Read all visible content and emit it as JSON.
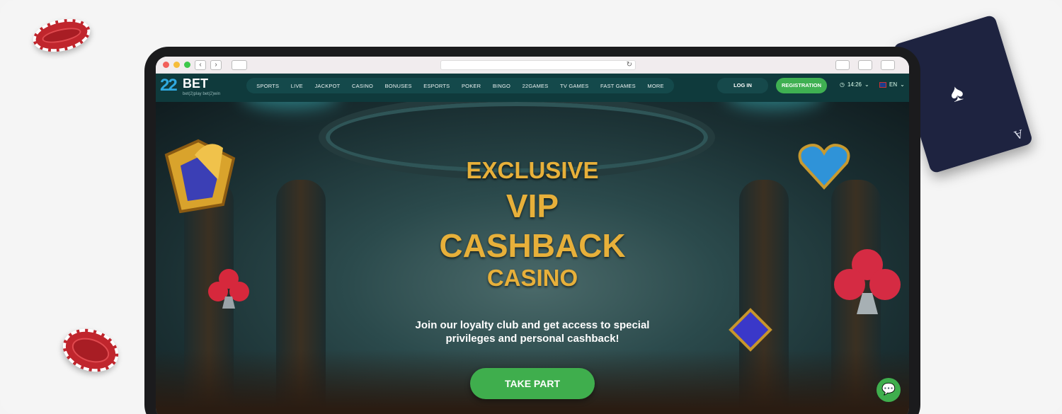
{
  "site": {
    "logo": {
      "mark": "22",
      "name": "BET",
      "tagline": "bet(2)play  bet(2)win"
    },
    "menu": [
      "SPORTS",
      "LIVE",
      "JACKPOT",
      "CASINO",
      "BONUSES",
      "ESPORTS",
      "POKER",
      "BINGO",
      "22GAMES",
      "TV GAMES",
      "FAST GAMES",
      "MORE"
    ],
    "login_label": "LOG IN",
    "registration_label": "REGISTRATION",
    "time": "14:26",
    "language": "EN"
  },
  "hero": {
    "line1": "EXCLUSIVE",
    "line2": "VIP",
    "line3": "CASHBACK",
    "line4": "CASINO",
    "subtitle_line1": "Join our loyalty club and get access to special",
    "subtitle_line2": "privileges and personal cashback!",
    "cta_label": "TAKE PART"
  },
  "colors": {
    "accent_green": "#3fae4d",
    "gold": "#e7b03a",
    "nav_bg": "#0f3a3c"
  },
  "icons": [
    "back-icon",
    "forward-icon",
    "sidebar-icon",
    "reload-icon",
    "share-icon",
    "tabs-icon",
    "download-icon",
    "clock-icon",
    "flag-icon",
    "chat-icon"
  ]
}
